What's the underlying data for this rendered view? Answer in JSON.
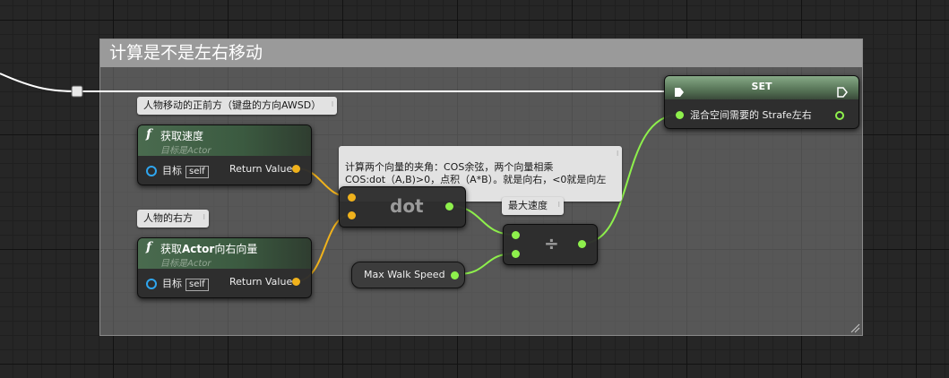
{
  "comment": {
    "title": "计算是不是左右移动"
  },
  "bubbles": {
    "forward": "人物移动的正前方（键盘的方向AWSD）",
    "right": "人物的右方",
    "angle": "计算两个向量的夹角：COS余弦，两个向量相乘\nCOS:dot（A,B)>0，点积（A*B）。就是向右，<0就是向左",
    "max_speed": "最大速度"
  },
  "get_velocity": {
    "title": "获取速度",
    "subtitle": "目标是Actor",
    "target_label": "目标",
    "target_value": "self",
    "output_label": "Return Value"
  },
  "get_right_vector": {
    "title_prefix": "获取",
    "title_bold": "Actor",
    "title_suffix": "向右向量",
    "subtitle": "目标是Actor",
    "target_label": "目标",
    "target_value": "self",
    "output_label": "Return Value"
  },
  "dot_node": {
    "title": "dot"
  },
  "divide_node": {
    "title": "÷"
  },
  "max_walk_speed": {
    "label": "Max Walk Speed"
  },
  "set_node": {
    "title": "SET",
    "variable_label": "混合空间需要的 Strafe左右"
  },
  "colors": {
    "exec_wire": "#ffffff",
    "vector_wire": "#f0b21c",
    "float_wire": "#8ef04c",
    "object_pin": "#2fa6ef",
    "function_header": "#4a6b4f"
  },
  "icons": {
    "function": "function-icon",
    "pin": "pin-icon",
    "exec_in": "exec-in-icon",
    "exec_out": "exec-out-icon"
  }
}
